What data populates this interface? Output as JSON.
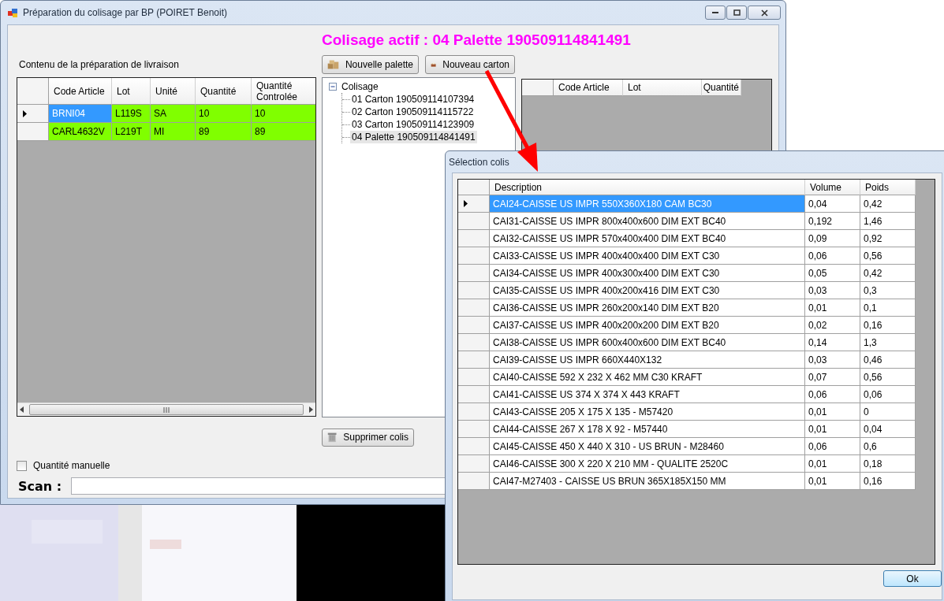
{
  "main_window": {
    "title": "Préparation du colisage par BP (POIRET Benoit)",
    "active_packing": "Colisage actif : 04 Palette 190509114841491",
    "content_label": "Contenu de la préparation de livraison",
    "buttons": [
      {
        "label": "Nouvelle palette",
        "kind": "pallet"
      },
      {
        "label": "Nouveau carton",
        "kind": "carton"
      }
    ],
    "items_grid": {
      "columns": [
        "Code Article",
        "Lot",
        "Unité",
        "Quantité",
        "Quantité Controlée"
      ],
      "rows": [
        {
          "current": true,
          "controlled": true,
          "cells": [
            {
              "text": "BRNI04",
              "selected": true
            },
            {
              "text": "L119S",
              "selected": false
            },
            {
              "text": "SA",
              "selected": false
            },
            {
              "text": "10",
              "selected": false
            },
            {
              "text": "10",
              "selected": false
            }
          ]
        },
        {
          "current": false,
          "controlled": true,
          "cells": [
            {
              "text": "CARL4632V",
              "selected": false
            },
            {
              "text": "L219T",
              "selected": false
            },
            {
              "text": "MI",
              "selected": false
            },
            {
              "text": "89",
              "selected": false
            },
            {
              "text": "89",
              "selected": false
            }
          ]
        }
      ]
    },
    "tree": {
      "label": "Colisage",
      "expanded": true,
      "children": [
        {
          "label": "01 Carton 190509114107394",
          "selected": false
        },
        {
          "label": "02 Carton 190509114115722",
          "selected": false
        },
        {
          "label": "03 Carton 190509114123909",
          "selected": false
        },
        {
          "label": "04 Palette 190509114841491",
          "selected": true
        }
      ]
    },
    "package_grid": {
      "columns": [
        "Code Article",
        "Lot",
        "Quantité"
      ]
    },
    "delete_button": "Supprimer colis",
    "manual_quantity": {
      "label": "Quantité manuelle",
      "checked": false
    },
    "scan_label": "Scan :"
  },
  "dialog": {
    "title": "Sélection colis",
    "columns": [
      "Description",
      "Volume",
      "Poids"
    ],
    "rows": [
      {
        "description": "CAI24-CAISSE US IMPR 550X360X180 CAM BC30",
        "volume": "0,04",
        "weight": "0,42",
        "selected": true
      },
      {
        "description": "CAI31-CAISSE US IMPR 800x400x600 DIM EXT BC40",
        "volume": "0,192",
        "weight": "1,46",
        "selected": false
      },
      {
        "description": "CAI32-CAISSE US IMPR 570x400x400 DIM EXT BC40",
        "volume": "0,09",
        "weight": "0,92",
        "selected": false
      },
      {
        "description": "CAI33-CAISSE US IMPR 400x400x400 DIM EXT C30",
        "volume": "0,06",
        "weight": "0,56",
        "selected": false
      },
      {
        "description": "CAI34-CAISSE US IMPR 400x300x400 DIM EXT C30",
        "volume": "0,05",
        "weight": "0,42",
        "selected": false
      },
      {
        "description": "CAI35-CAISSE US IMPR 400x200x416 DIM EXT C30",
        "volume": "0,03",
        "weight": "0,3",
        "selected": false
      },
      {
        "description": "CAI36-CAISSE US IMPR 260x200x140 DIM EXT B20",
        "volume": "0,01",
        "weight": "0,1",
        "selected": false
      },
      {
        "description": "CAI37-CAISSE US IMPR 400x200x200 DIM EXT B20",
        "volume": "0,02",
        "weight": "0,16",
        "selected": false
      },
      {
        "description": "CAI38-CAISSE US IMPR 600x400x600 DIM EXT BC40",
        "volume": "0,14",
        "weight": "1,3",
        "selected": false
      },
      {
        "description": "CAI39-CAISSE US IMPR 660X440X132",
        "volume": "0,03",
        "weight": "0,46",
        "selected": false
      },
      {
        "description": "CAI40-CAISSE 592 X 232 X 462 MM C30 KRAFT",
        "volume": "0,07",
        "weight": "0,56",
        "selected": false
      },
      {
        "description": "CAI41-CAISSE US 374 X 374 X 443 KRAFT",
        "volume": "0,06",
        "weight": "0,06",
        "selected": false
      },
      {
        "description": "CAI43-CAISSE 205 X 175 X 135 - M57420",
        "volume": "0,01",
        "weight": "0",
        "selected": false
      },
      {
        "description": "CAI44-CAISSE 267 X 178 X 92 - M57440",
        "volume": "0,01",
        "weight": "0,04",
        "selected": false
      },
      {
        "description": "CAI45-CAISSE 450 X 440 X 310 - US BRUN - M28460",
        "volume": "0,06",
        "weight": "0,6",
        "selected": false
      },
      {
        "description": "CAI46-CAISSE 300  X 220  X 210 MM - QUALITE 2520C",
        "volume": "0,01",
        "weight": "0,18",
        "selected": false
      },
      {
        "description": "CAI47-M27403  -  CAISSE US BRUN 365X185X150 MM",
        "volume": "0,01",
        "weight": "0,16",
        "selected": false
      }
    ],
    "ok_button": "Ok"
  }
}
